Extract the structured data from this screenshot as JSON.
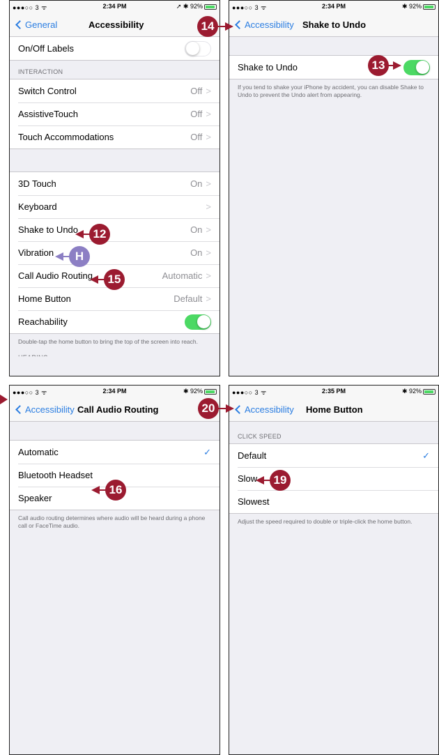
{
  "accent_color": "#2a7de1",
  "toggle_on_color": "#4cd964",
  "callout_color": "#9b1b30",
  "callout_alt_color": "#8c7fc4",
  "screens": [
    {
      "status": {
        "carrier": "●●●○○ 3 ᯤ",
        "time": "2:34 PM",
        "right": "➚ ✱ 92%"
      },
      "nav": {
        "back": "General",
        "title": "Accessibility"
      },
      "top_row": {
        "label": "On/Off Labels",
        "toggle": "off"
      },
      "interaction_header": "INTERACTION",
      "interaction": [
        {
          "label": "Switch Control",
          "value": "Off"
        },
        {
          "label": "AssistiveTouch",
          "value": "Off"
        },
        {
          "label": "Touch Accommodations",
          "value": "Off"
        }
      ],
      "settings": [
        {
          "label": "3D Touch",
          "value": "On"
        },
        {
          "label": "Keyboard",
          "value": ""
        },
        {
          "label": "Shake to Undo",
          "value": "On"
        },
        {
          "label": "Vibration",
          "value": "On"
        },
        {
          "label": "Call Audio Routing",
          "value": "Automatic"
        },
        {
          "label": "Home Button",
          "value": "Default"
        }
      ],
      "reachability": {
        "label": "Reachability",
        "toggle": "on"
      },
      "footer": "Double-tap the home button to bring the top of the screen into reach.",
      "next_header": "HEARING"
    },
    {
      "status": {
        "carrier": "●●●○○ 3 ᯤ",
        "time": "2:34 PM",
        "right": "✱ 92%"
      },
      "nav": {
        "back": "Accessibility",
        "title": "Shake to Undo"
      },
      "row": {
        "label": "Shake to Undo",
        "toggle": "on"
      },
      "footer": "If you tend to shake your iPhone by accident, you can disable Shake to Undo to prevent the Undo alert from appearing."
    },
    {
      "status": {
        "carrier": "●●●○○ 3 ᯤ",
        "time": "2:34 PM",
        "right": "✱ 92%"
      },
      "nav": {
        "back": "Accessibility",
        "title": "Call Audio Routing"
      },
      "options": [
        {
          "label": "Automatic",
          "checked": true
        },
        {
          "label": "Bluetooth Headset",
          "checked": false
        },
        {
          "label": "Speaker",
          "checked": false
        }
      ],
      "footer": "Call audio routing determines where audio will be heard during a phone call or FaceTime audio."
    },
    {
      "status": {
        "carrier": "●●●○○ 3 ᯤ",
        "time": "2:35 PM",
        "right": "✱ 92%"
      },
      "nav": {
        "back": "Accessibility",
        "title": "Home Button"
      },
      "header": "CLICK SPEED",
      "options": [
        {
          "label": "Default",
          "checked": true
        },
        {
          "label": "Slow",
          "checked": false
        },
        {
          "label": "Slowest",
          "checked": false
        }
      ],
      "footer": "Adjust the speed required to double or triple-click the home button."
    }
  ],
  "callouts": {
    "c12": "12",
    "c13": "13",
    "c14": "14",
    "cH": "H",
    "c15": "15",
    "c16": "16",
    "c19": "19",
    "c20": "20"
  },
  "checkmark": "✓",
  "chevron": ">"
}
